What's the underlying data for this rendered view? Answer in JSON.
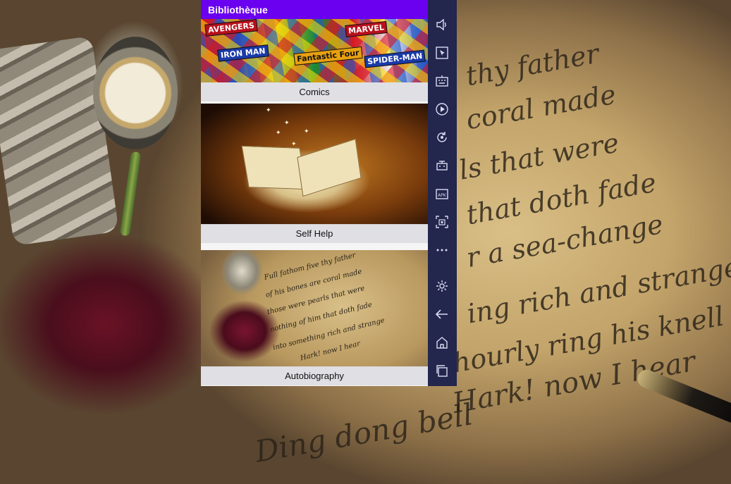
{
  "app": {
    "title": "Bibliothèque"
  },
  "categories": [
    {
      "label": "Comics"
    },
    {
      "label": "Self Help"
    },
    {
      "label": "Autobiography"
    }
  ],
  "comics_cover_text": [
    "AVENGERS",
    "IRON MAN",
    "Fantastic Four",
    "MARVEL",
    "SPIDER-MAN"
  ],
  "toolbar": {
    "icons": [
      "volume-icon",
      "cursor-icon",
      "keyboard-icon",
      "play-record-icon",
      "rotate-icon",
      "keymap-icon",
      "apk-icon",
      "screenshot-icon",
      "more-icon",
      "settings-icon",
      "back-icon",
      "home-icon",
      "recents-icon"
    ]
  },
  "colors": {
    "app_bar": "#6a00ef",
    "toolbar": "#23264d",
    "label_bg": "#dedee2"
  }
}
